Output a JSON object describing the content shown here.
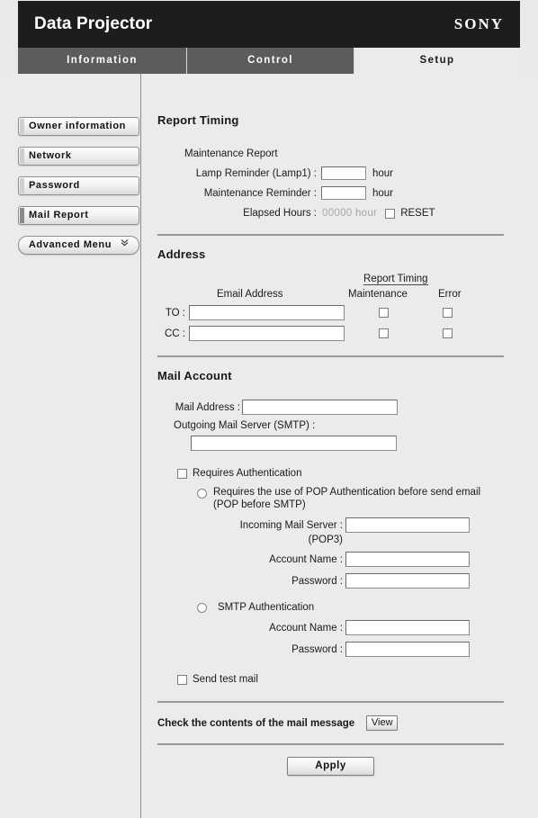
{
  "header": {
    "title": "Data Projector",
    "brand": "SONY"
  },
  "tabs": [
    {
      "label": "Information",
      "active": false
    },
    {
      "label": "Control",
      "active": false
    },
    {
      "label": "Setup",
      "active": true
    }
  ],
  "sidebar": {
    "items": [
      {
        "label": "Owner information",
        "selected": false
      },
      {
        "label": "Network",
        "selected": false
      },
      {
        "label": "Password",
        "selected": false
      },
      {
        "label": "Mail Report",
        "selected": true
      }
    ],
    "advanced": {
      "label": "Advanced Menu",
      "icon": "chevron-double-down-icon",
      "glyph": "»"
    }
  },
  "report_timing": {
    "title": "Report Timing",
    "maintenance_report_label": "Maintenance Report",
    "lamp_reminder_label": "Lamp Reminder (Lamp1) :",
    "lamp_reminder_value": "",
    "lamp_reminder_unit": "hour",
    "maintenance_reminder_label": "Maintenance Reminder :",
    "maintenance_reminder_value": "",
    "maintenance_reminder_unit": "hour",
    "elapsed_hours_label": "Elapsed Hours :",
    "elapsed_hours_value": "00000 hour",
    "reset_label": "RESET"
  },
  "address": {
    "title": "Address",
    "email_address_header": "Email Address",
    "report_timing_header": "Report Timing",
    "maintenance_header": "Maintenance",
    "error_header": "Error",
    "rows": [
      {
        "label": "TO :",
        "value": ""
      },
      {
        "label": "CC :",
        "value": ""
      }
    ]
  },
  "mail_account": {
    "title": "Mail Account",
    "mail_address_label": "Mail Address :",
    "mail_address_value": "",
    "smtp_label": "Outgoing Mail Server (SMTP) :",
    "smtp_value": "",
    "requires_auth_label": "Requires Authentication",
    "pop_radio_line1": "Requires the use of POP Authentication before send email",
    "pop_radio_line2": "(POP before SMTP)",
    "pop_server_label_line1": "Incoming Mail Server :",
    "pop_server_label_line2": "(POP3)",
    "pop_server_value": "",
    "pop_account_label": "Account Name :",
    "pop_account_value": "",
    "pop_password_label": "Password :",
    "pop_password_value": "",
    "smtp_auth_label": "SMTP Authentication",
    "smtp_account_label": "Account Name :",
    "smtp_account_value": "",
    "smtp_password_label": "Password :",
    "smtp_password_value": "",
    "send_test_mail_label": "Send test mail"
  },
  "footer": {
    "check_contents_label": "Check the contents of the mail message",
    "view_label": "View",
    "apply_label": "Apply"
  }
}
